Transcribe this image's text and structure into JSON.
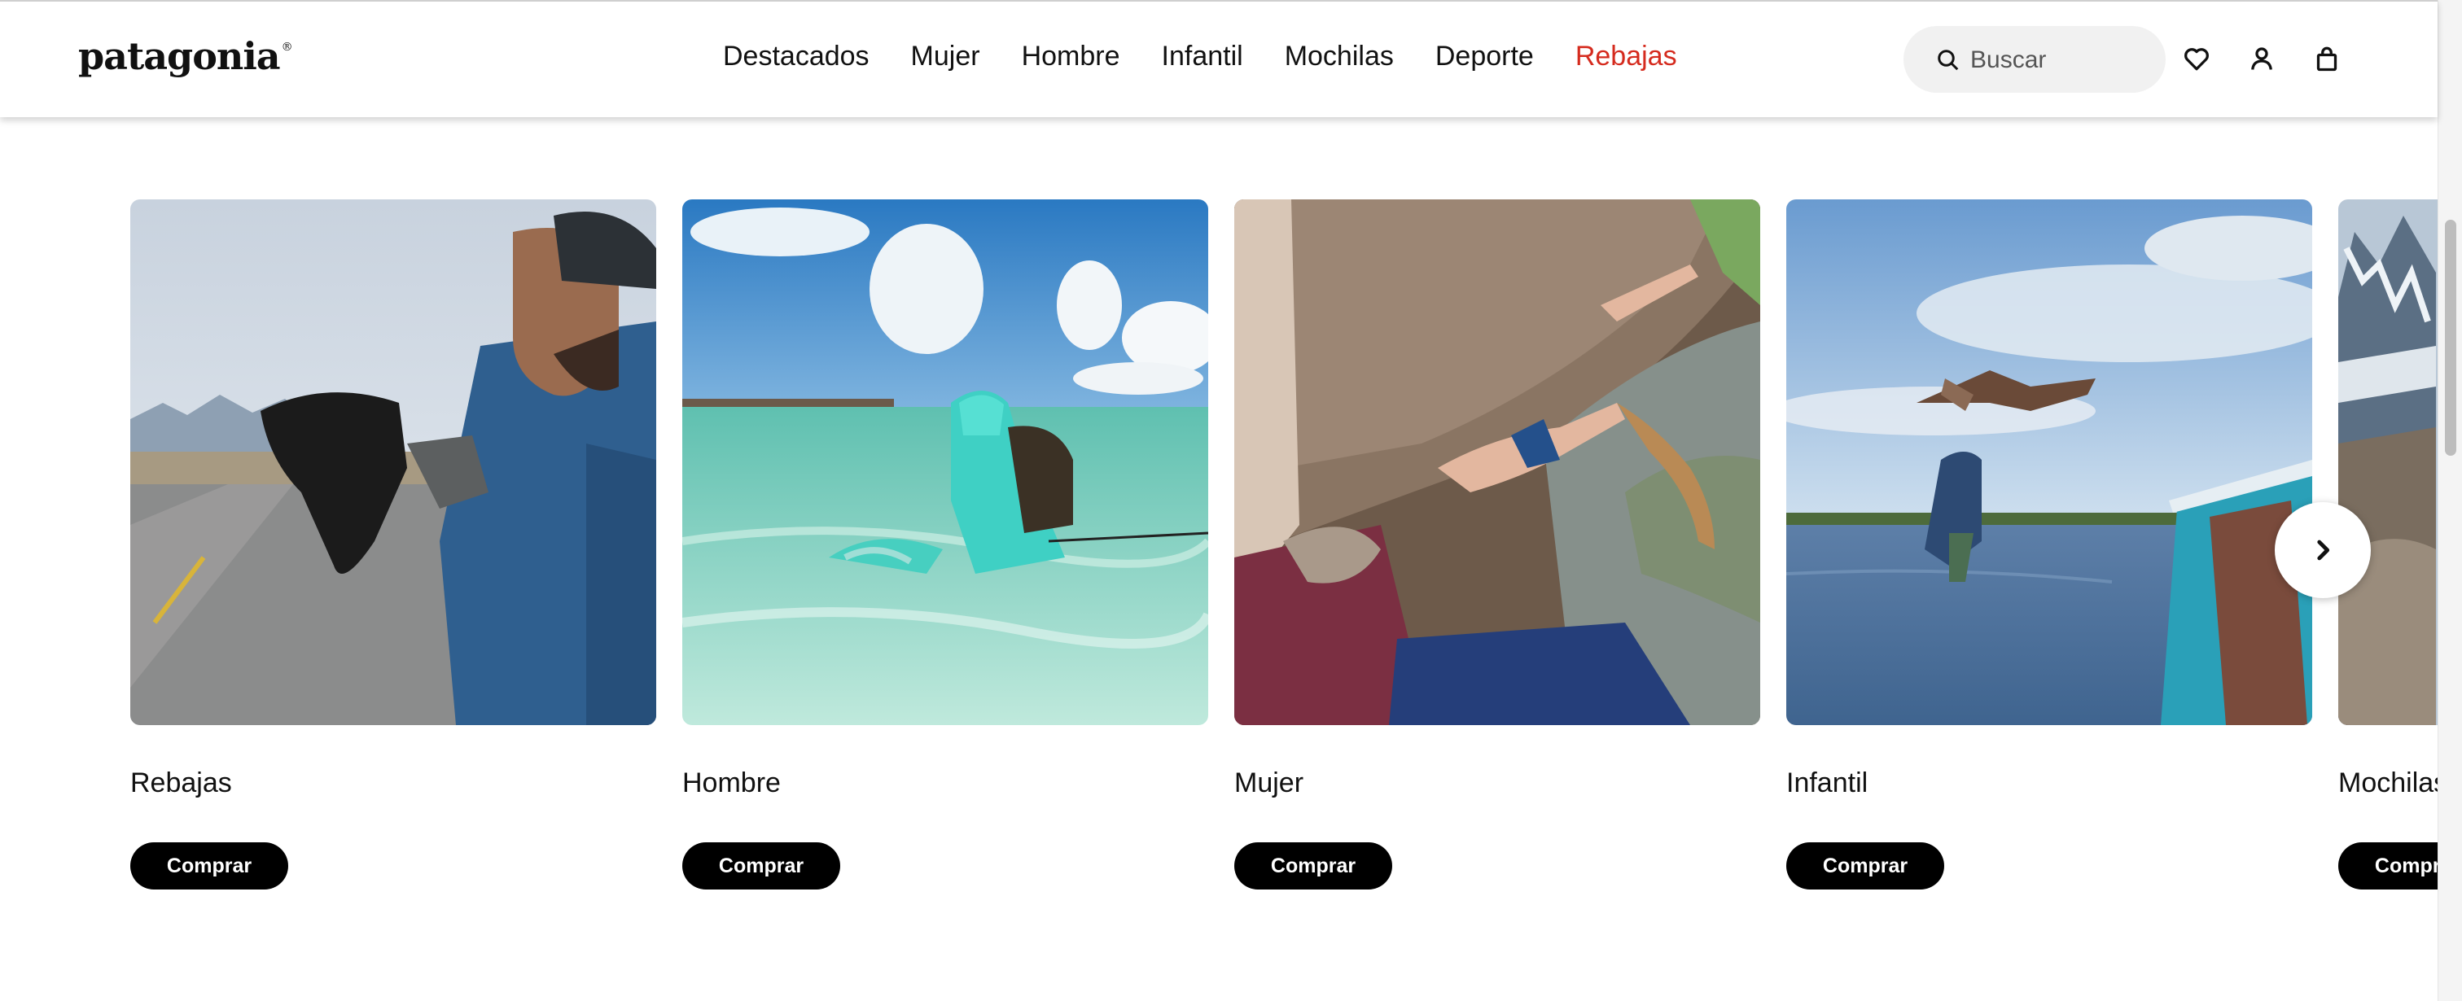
{
  "header": {
    "logo": "patagonia",
    "nav": [
      "Destacados",
      "Mujer",
      "Hombre",
      "Infantil",
      "Mochilas",
      "Deporte",
      "Rebajas"
    ],
    "search_placeholder": "Buscar",
    "icons": [
      "search-icon",
      "heart-icon",
      "user-icon",
      "bag-icon"
    ],
    "sale_color": "#d52b1e"
  },
  "cards": [
    {
      "title": "Rebajas",
      "button": "Comprar"
    },
    {
      "title": "Hombre",
      "button": "Comprar"
    },
    {
      "title": "Mujer",
      "button": "Comprar"
    },
    {
      "title": "Infantil",
      "button": "Comprar"
    },
    {
      "title": "Mochilas",
      "button": "Comprar"
    }
  ],
  "carousel": {
    "next_icon": "chevron-right-icon"
  }
}
